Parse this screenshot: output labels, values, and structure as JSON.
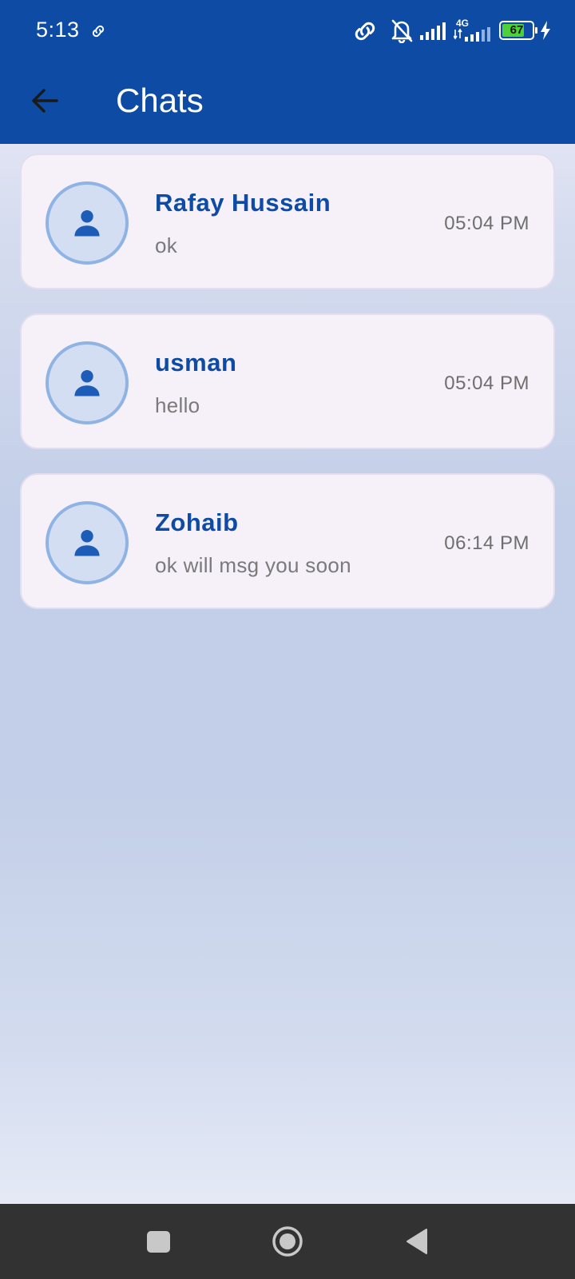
{
  "status_bar": {
    "time": "5:13",
    "network_type": "4G",
    "battery_level": "67",
    "icons": [
      "link-icon",
      "hotspot-icon",
      "bell-off-icon",
      "signal-icon",
      "signal-4g-icon",
      "battery-icon",
      "charging-icon"
    ]
  },
  "app_bar": {
    "title": "Chats",
    "back_icon": "arrow-left-icon"
  },
  "chats": [
    {
      "name": "Rafay Hussain",
      "last_message": "ok",
      "time": "05:04 PM"
    },
    {
      "name": "usman",
      "last_message": "hello",
      "time": "05:04 PM"
    },
    {
      "name": "Zohaib",
      "last_message": "ok will msg you soon",
      "time": "06:14 PM"
    }
  ],
  "nav_bar": {
    "buttons": [
      "recents-square-icon",
      "home-circle-icon",
      "back-triangle-icon"
    ]
  },
  "colors": {
    "primary": "#0d4ba4",
    "card_background": "#f6f0f9",
    "avatar_fill": "#d4def3",
    "avatar_border": "#8fb3e3",
    "message_text": "#7a7a7a",
    "nav_bar": "#323232"
  }
}
